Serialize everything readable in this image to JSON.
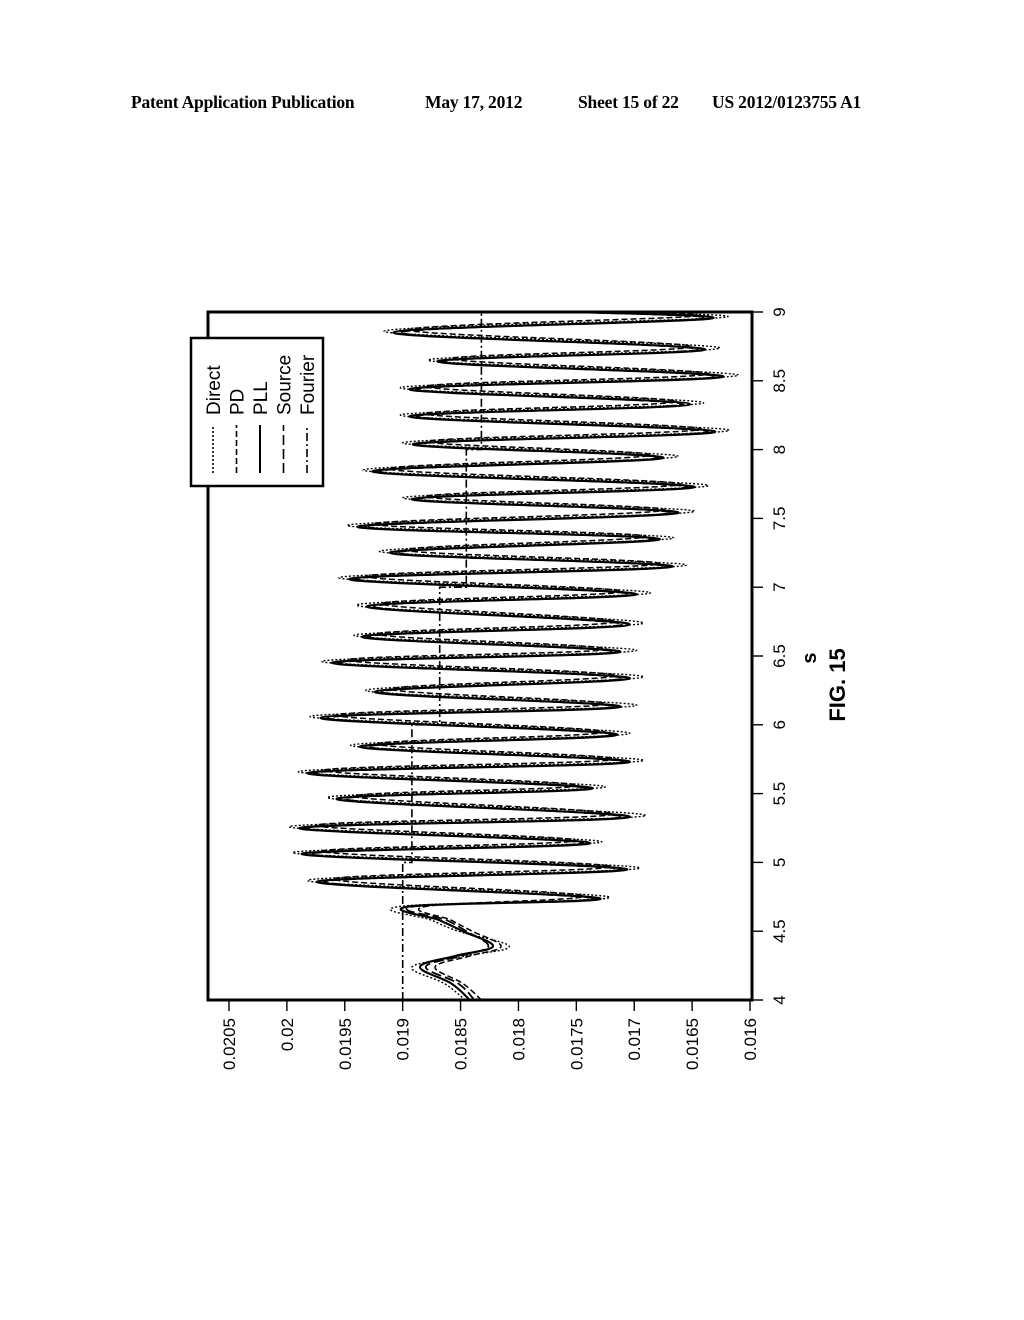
{
  "header": {
    "left": "Patent Application Publication",
    "date": "May 17, 2012",
    "sheet": "Sheet 15 of 22",
    "number": "US 2012/0123755 A1"
  },
  "figure_label": "FIG. 15",
  "chart_data": {
    "type": "line",
    "title": "",
    "xlabel": "s",
    "ylabel": "",
    "xlim": [
      4,
      9
    ],
    "ylim": [
      0.016,
      0.0205
    ],
    "x_ticks": [
      4,
      4.5,
      5,
      5.5,
      6,
      6.5,
      7,
      7.5,
      8,
      8.5,
      9
    ],
    "x_tick_labels": [
      "4",
      "4.5",
      "5",
      "5.5",
      "6",
      "6.5",
      "7",
      "7.5",
      "8",
      "8.5",
      "9"
    ],
    "y_ticks": [
      0.016,
      0.0165,
      0.017,
      0.0175,
      0.018,
      0.0185,
      0.019,
      0.0195,
      0.02,
      0.0205
    ],
    "y_tick_labels": [
      "0.016",
      "0.0165",
      "0.017",
      "0.0175",
      "0.018",
      "0.0185",
      "0.019",
      "0.0195",
      "0.02",
      "0.0205"
    ],
    "grid": false,
    "orientation": "rotated 90 degrees counter-clockwise on page",
    "legend": {
      "placement": "top-left",
      "entries": [
        {
          "name": "Direct",
          "style": "dotted"
        },
        {
          "name": "PD",
          "style": "dashed"
        },
        {
          "name": "PLL",
          "style": "solid"
        },
        {
          "name": "Source",
          "style": "long-dash"
        },
        {
          "name": "Fourier",
          "style": "dash-dot"
        }
      ]
    },
    "series": [
      {
        "name": "PLL",
        "style": "solid",
        "x": [
          4.0,
          4.12,
          4.24,
          4.32,
          4.39,
          4.5,
          4.58,
          4.68,
          4.74,
          4.86,
          4.95,
          5.06,
          5.14,
          5.25,
          5.33,
          5.46,
          5.54,
          5.65,
          5.73,
          5.84,
          5.93,
          6.05,
          6.13,
          6.24,
          6.34,
          6.45,
          6.53,
          6.64,
          6.73,
          6.86,
          6.95,
          7.06,
          7.15,
          7.25,
          7.35,
          7.44,
          7.54,
          7.64,
          7.73,
          7.84,
          7.94,
          8.04,
          8.13,
          8.24,
          8.33,
          8.44,
          8.53,
          8.64,
          8.73,
          8.85,
          8.95,
          9.0
        ],
        "y": [
          0.01842,
          0.01858,
          0.01885,
          0.01855,
          0.01822,
          0.01848,
          0.01868,
          0.01894,
          0.0173,
          0.01974,
          0.01706,
          0.01987,
          0.01738,
          0.01989,
          0.01704,
          0.01957,
          0.01736,
          0.01982,
          0.01704,
          0.01937,
          0.01715,
          0.01971,
          0.01712,
          0.01924,
          0.01704,
          0.01961,
          0.01712,
          0.01935,
          0.01704,
          0.01931,
          0.01698,
          0.01946,
          0.01667,
          0.01911,
          0.01678,
          0.01939,
          0.01662,
          0.01892,
          0.01648,
          0.01926,
          0.01675,
          0.01891,
          0.0163,
          0.01894,
          0.01652,
          0.01894,
          0.01623,
          0.0187,
          0.01639,
          0.01908,
          0.01636,
          0.01747
        ]
      },
      {
        "name": "Source",
        "style": "long-dash",
        "x": [
          4.0,
          4.12,
          4.24,
          4.32,
          4.39,
          4.5,
          4.58,
          4.68,
          4.74,
          4.86,
          4.95,
          5.06,
          5.14,
          5.25,
          5.33,
          5.46,
          5.54,
          5.65,
          5.73,
          5.84,
          5.93,
          6.05,
          6.13,
          6.24,
          6.34,
          6.45,
          6.53,
          6.64,
          6.73,
          6.86,
          6.95,
          7.06,
          7.15,
          7.25,
          7.35,
          7.44,
          7.54,
          7.64,
          7.73,
          7.84,
          7.94,
          8.04,
          8.13,
          8.24,
          8.33,
          8.44,
          8.53,
          8.64,
          8.73,
          8.85,
          8.95,
          9.0
        ],
        "y": [
          0.01838,
          0.01852,
          0.0188,
          0.0185,
          0.01826,
          0.01845,
          0.01862,
          0.0189,
          0.01736,
          0.01968,
          0.01712,
          0.0198,
          0.01744,
          0.01983,
          0.0171,
          0.0195,
          0.01742,
          0.01976,
          0.0171,
          0.0193,
          0.0172,
          0.01965,
          0.01718,
          0.01918,
          0.0171,
          0.01955,
          0.01718,
          0.0193,
          0.0171,
          0.01925,
          0.01704,
          0.0194,
          0.01672,
          0.01905,
          0.01684,
          0.01933,
          0.01668,
          0.01887,
          0.01654,
          0.0192,
          0.0168,
          0.01886,
          0.01636,
          0.01888,
          0.01658,
          0.01888,
          0.01629,
          0.01865,
          0.01645,
          0.01902,
          0.01642,
          0.01752
        ]
      },
      {
        "name": "PD",
        "style": "dashed",
        "x": [
          4.0,
          4.12,
          4.24,
          4.32,
          4.39,
          4.5,
          4.58,
          4.68,
          4.76,
          4.88,
          4.97,
          5.08,
          5.16,
          5.27,
          5.35,
          5.48,
          5.56,
          5.67,
          5.75,
          5.86,
          5.95,
          6.07,
          6.15,
          6.26,
          6.36,
          6.47,
          6.55,
          6.66,
          6.75,
          6.88,
          6.97,
          7.08,
          7.17,
          7.27,
          7.37,
          7.46,
          7.56,
          7.66,
          7.75,
          7.86,
          7.96,
          8.06,
          8.15,
          8.26,
          8.35,
          8.46,
          8.55,
          8.66,
          8.75,
          8.87,
          8.97,
          9.0
        ],
        "y": [
          0.01832,
          0.01848,
          0.01872,
          0.01842,
          0.01815,
          0.0184,
          0.01858,
          0.0188,
          0.01745,
          0.0196,
          0.0172,
          0.0197,
          0.0175,
          0.01975,
          0.01718,
          0.01942,
          0.01748,
          0.01968,
          0.01716,
          0.01922,
          0.01726,
          0.01958,
          0.01724,
          0.0191,
          0.01716,
          0.01948,
          0.01724,
          0.01922,
          0.01716,
          0.01918,
          0.0171,
          0.01932,
          0.01678,
          0.01898,
          0.0169,
          0.01926,
          0.01674,
          0.0188,
          0.0166,
          0.01912,
          0.01686,
          0.01878,
          0.01642,
          0.0188,
          0.01664,
          0.0188,
          0.01636,
          0.01858,
          0.0165,
          0.01895,
          0.01648,
          0.0176
        ]
      },
      {
        "name": "Direct",
        "style": "dotted",
        "x": [
          4.0,
          4.12,
          4.24,
          4.32,
          4.39,
          4.5,
          4.58,
          4.68,
          4.75,
          4.87,
          4.96,
          5.07,
          5.15,
          5.26,
          5.34,
          5.47,
          5.55,
          5.66,
          5.74,
          5.85,
          5.94,
          6.06,
          6.14,
          6.25,
          6.35,
          6.46,
          6.54,
          6.65,
          6.74,
          6.87,
          6.96,
          7.07,
          7.16,
          7.26,
          7.36,
          7.45,
          7.55,
          7.65,
          7.74,
          7.85,
          7.95,
          8.05,
          8.14,
          8.25,
          8.34,
          8.45,
          8.54,
          8.65,
          8.74,
          8.86,
          8.96,
          9.0
        ],
        "y": [
          0.01846,
          0.01864,
          0.01892,
          0.01846,
          0.01808,
          0.01852,
          0.01875,
          0.01902,
          0.01722,
          0.01982,
          0.01695,
          0.01995,
          0.01728,
          0.01998,
          0.0169,
          0.01965,
          0.01725,
          0.0199,
          0.01692,
          0.01945,
          0.01704,
          0.0198,
          0.01698,
          0.01932,
          0.01692,
          0.0197,
          0.01698,
          0.01942,
          0.01692,
          0.0194,
          0.01686,
          0.01955,
          0.01655,
          0.0192,
          0.01666,
          0.01948,
          0.01648,
          0.019,
          0.01636,
          0.01934,
          0.01662,
          0.019,
          0.01618,
          0.01902,
          0.0164,
          0.01902,
          0.0161,
          0.01878,
          0.01626,
          0.01916,
          0.01624,
          0.0174
        ]
      },
      {
        "name": "Fourier",
        "style": "dash-dot",
        "x": [
          4.0,
          5.0,
          5.0,
          6.0,
          6.0,
          7.0,
          7.0,
          8.0,
          8.0,
          9.0
        ],
        "y": [
          0.019,
          0.019,
          0.01892,
          0.01892,
          0.01868,
          0.01868,
          0.01845,
          0.01845,
          0.01832,
          0.01832
        ]
      }
    ]
  }
}
